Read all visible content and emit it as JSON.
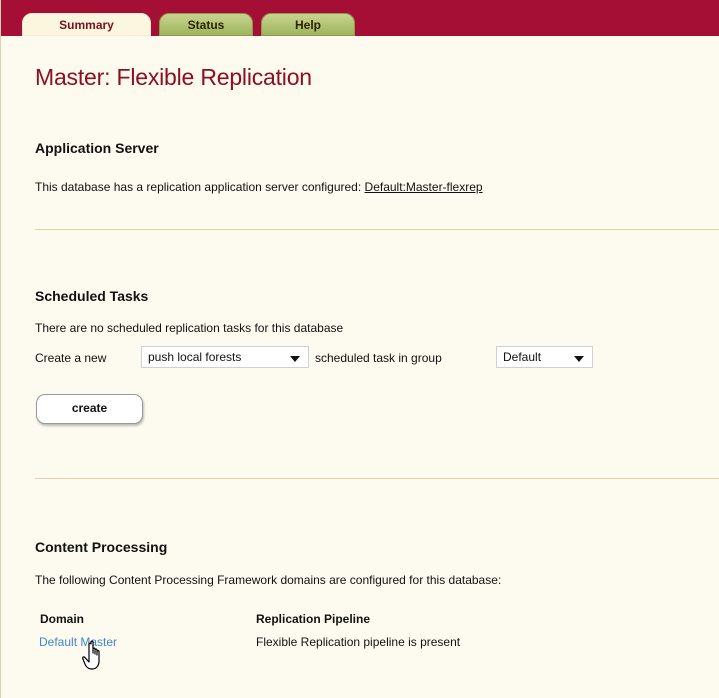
{
  "tabs": [
    {
      "label": "Summary",
      "active": true
    },
    {
      "label": "Status",
      "active": false
    },
    {
      "label": "Help",
      "active": false
    }
  ],
  "page_title": "Master: Flexible Replication",
  "app_server": {
    "heading": "Application Server",
    "text": "This database has a replication application server configured: ",
    "link": "Default:Master-flexrep"
  },
  "scheduled_tasks": {
    "heading": "Scheduled Tasks",
    "no_tasks_text": "There are no scheduled replication tasks for this database",
    "create_prefix": "Create a new",
    "task_type_selected": "push local forests",
    "create_middle": "scheduled task in group",
    "group_selected": "Default",
    "create_button": "create"
  },
  "content_processing": {
    "heading": "Content Processing",
    "text": "The following Content Processing Framework domains are configured for this database:",
    "columns": [
      "Domain",
      "Replication Pipeline"
    ],
    "rows": [
      {
        "domain": "Default Master",
        "pipeline": "Flexible Replication pipeline is present"
      }
    ]
  },
  "colors": {
    "tab_bar": "#a50f35",
    "title": "#8c1021",
    "link": "#3f87c7",
    "page_bg": "#fdfaf0"
  },
  "icons": {
    "cursor": "hand-pointer-icon",
    "dropdown": "chevron-down-icon"
  }
}
